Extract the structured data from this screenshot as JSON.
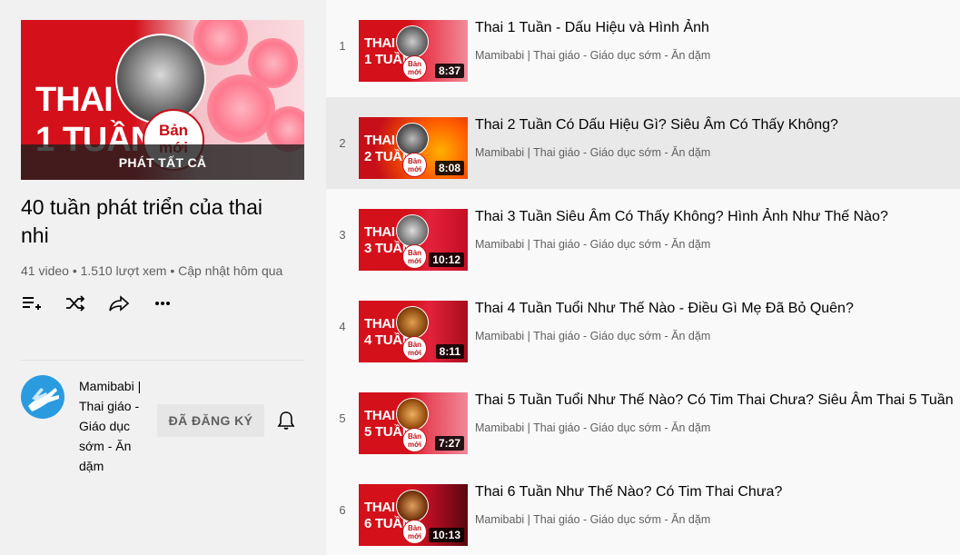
{
  "playlist": {
    "play_all": "PHÁT TẤT CẢ",
    "hero_line1": "THAI",
    "hero_line2": "1 TUẦN",
    "hero_badge_line1": "Bản",
    "hero_badge_line2": "mới",
    "title": "40 tuần phát triển của thai nhi",
    "meta": "41 video • 1.510 lượt xem • Cập nhật hôm qua",
    "actions": [
      "add-to-queue-icon",
      "shuffle-icon",
      "share-icon",
      "more-icon"
    ]
  },
  "owner": {
    "name": "Mamibabi | Thai giáo - Giáo dục sớm - Ăn dặm",
    "subscribe_label": "ĐÃ ĐĂNG KÝ",
    "accent": "#2b9be0"
  },
  "badge": {
    "line1": "Bản",
    "line2": "mới"
  },
  "videos": [
    {
      "index": "1",
      "title": "Thai 1 Tuần - Dấu Hiệu và Hình Ảnh",
      "channel": "Mamibabi | Thai giáo - Giáo dục sớm - Ăn dặm",
      "duration": "8:37",
      "thumb_line1": "THAI",
      "thumb_line2": "1 TUẦN"
    },
    {
      "index": "2",
      "title": "Thai 2 Tuần Có Dấu Hiệu Gì? Siêu Âm Có Thấy Không?",
      "channel": "Mamibabi | Thai giáo - Giáo dục sớm - Ăn dặm",
      "duration": "8:08",
      "thumb_line1": "THAI",
      "thumb_line2": "2 TUẦN"
    },
    {
      "index": "3",
      "title": "Thai 3 Tuần Siêu Âm Có Thấy Không? Hình Ảnh Như Thế Nào?",
      "channel": "Mamibabi | Thai giáo - Giáo dục sớm - Ăn dặm",
      "duration": "10:12",
      "thumb_line1": "THAI",
      "thumb_line2": "3 TUẦN"
    },
    {
      "index": "4",
      "title": "Thai 4 Tuần Tuổi Như Thế Nào - Điều Gì Mẹ Đã Bỏ Quên?",
      "channel": "Mamibabi | Thai giáo - Giáo dục sớm - Ăn dặm",
      "duration": "8:11",
      "thumb_line1": "THAI",
      "thumb_line2": "4 TUẦN"
    },
    {
      "index": "5",
      "title": "Thai 5 Tuần Tuổi Như Thế Nào? Có Tim Thai Chưa? Siêu Âm Thai 5 Tuần",
      "channel": "Mamibabi | Thai giáo - Giáo dục sớm - Ăn dặm",
      "duration": "7:27",
      "thumb_line1": "THAI",
      "thumb_line2": "5 TUẦN"
    },
    {
      "index": "6",
      "title": "Thai 6 Tuần Như Thế Nào? Có Tim Thai Chưa?",
      "channel": "Mamibabi | Thai giáo - Giáo dục sớm - Ăn dặm",
      "duration": "10:13",
      "thumb_line1": "THAI",
      "thumb_line2": "6 TUẦN"
    }
  ],
  "colors": {
    "brand_red": "#d4101a",
    "text_secondary": "#606060",
    "highlight_row": "#e9e9e9"
  }
}
